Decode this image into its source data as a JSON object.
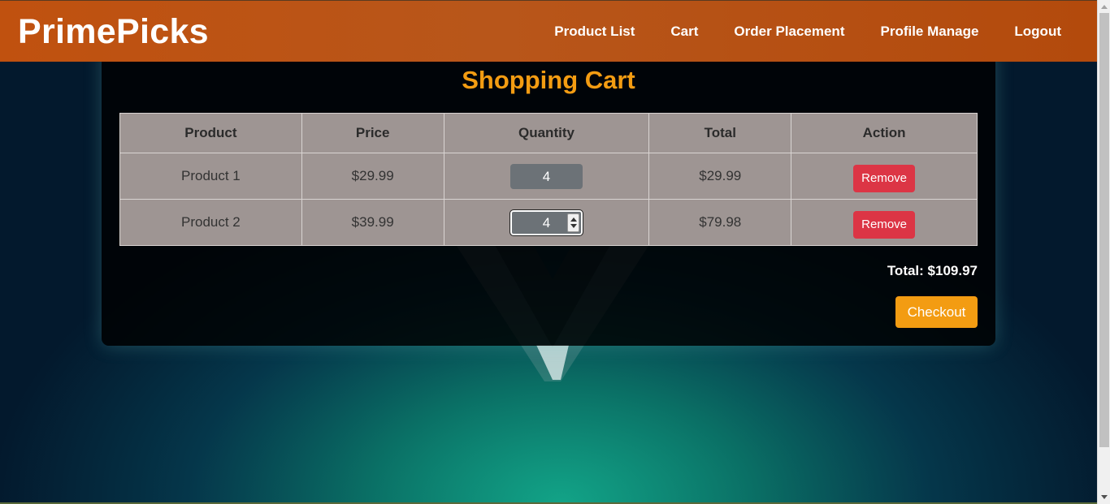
{
  "navbar": {
    "brand": "PrimePicks",
    "links": [
      "Product List",
      "Cart",
      "Order Placement",
      "Profile Manage",
      "Logout"
    ]
  },
  "cart": {
    "title": "Shopping Cart",
    "headers": [
      "Product",
      "Price",
      "Quantity",
      "Total",
      "Action"
    ],
    "rows": [
      {
        "product": "Product 1",
        "price": "$29.99",
        "quantity": "4",
        "total": "$29.99",
        "action": "Remove"
      },
      {
        "product": "Product 2",
        "price": "$39.99",
        "quantity": "4",
        "total": "$79.98",
        "action": "Remove"
      }
    ],
    "grand_total": "Total: $109.97",
    "checkout_label": "Checkout"
  },
  "colors": {
    "navbar": "#b8561a",
    "accent_orange": "#f39c12",
    "remove_red": "#dc3545",
    "table_bg": "#9e9593"
  }
}
